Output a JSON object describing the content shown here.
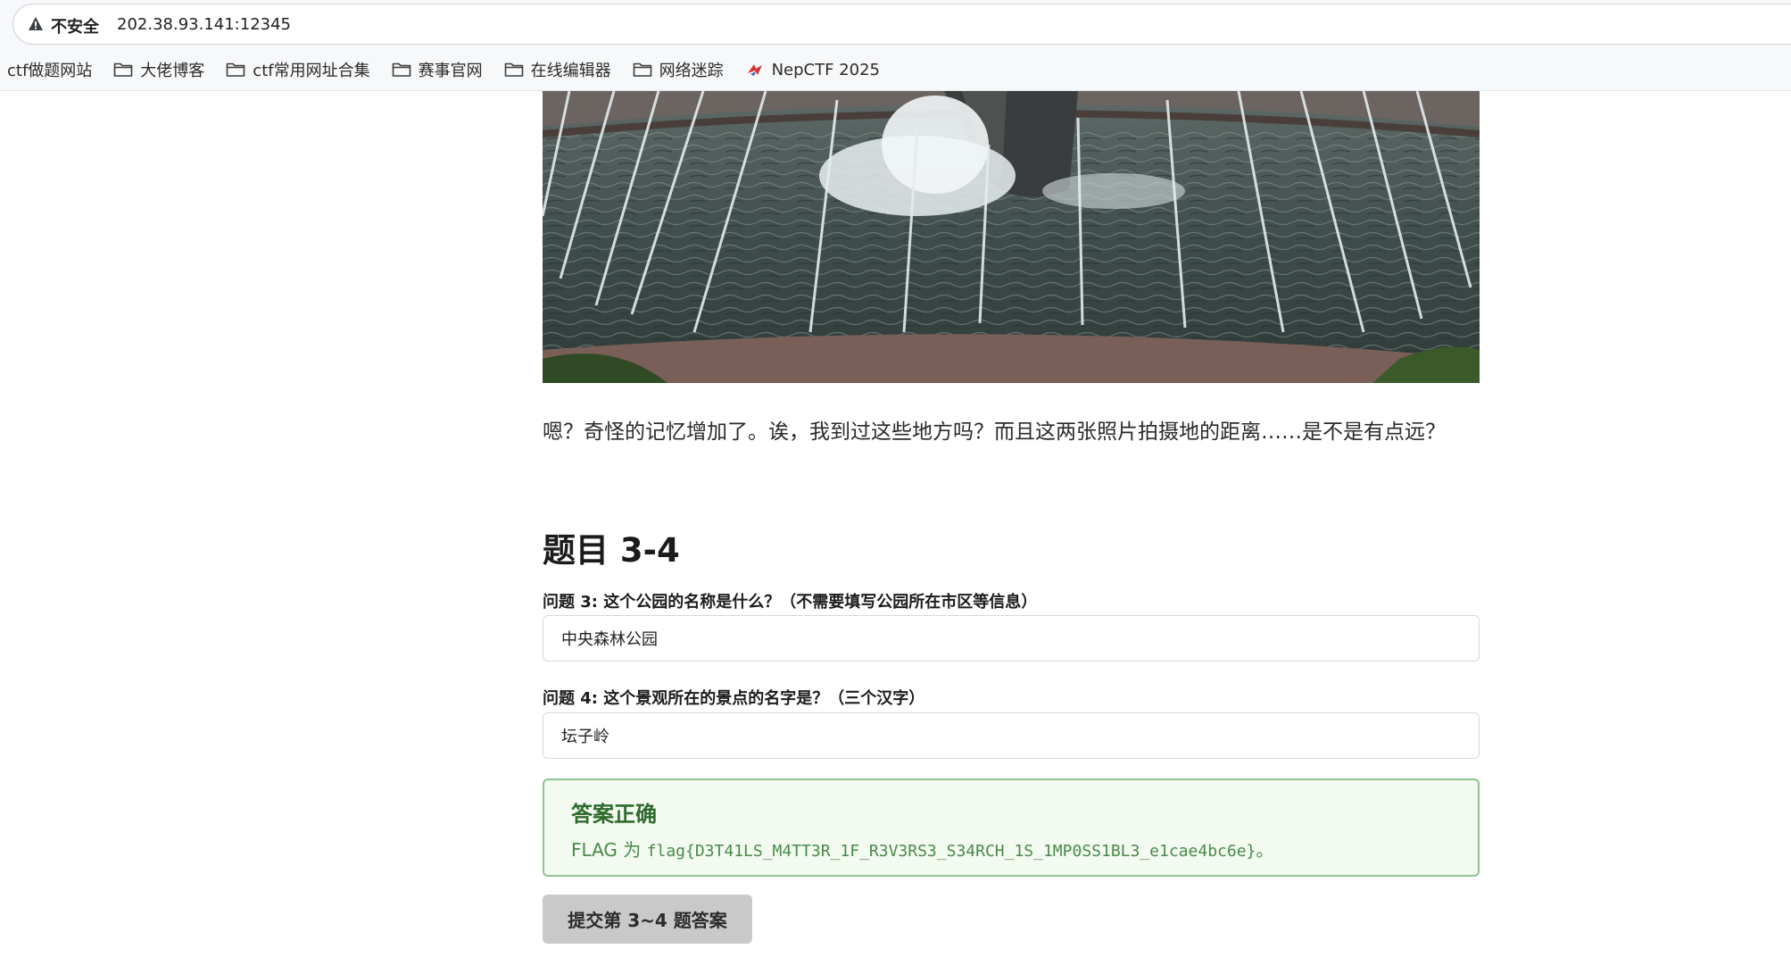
{
  "browser": {
    "security_label": "不安全",
    "url": "202.38.93.141:12345",
    "bookmarks": [
      {
        "label": "ctf做题网站",
        "icon": "folder-icon"
      },
      {
        "label": "大佬博客",
        "icon": "folder-icon"
      },
      {
        "label": "ctf常用网址合集",
        "icon": "folder-icon"
      },
      {
        "label": "赛事官网",
        "icon": "folder-icon"
      },
      {
        "label": "在线编辑器",
        "icon": "folder-icon"
      },
      {
        "label": "网络迷踪",
        "icon": "folder-icon"
      },
      {
        "label": "NepCTF 2025",
        "icon": "nepctf-favicon"
      }
    ]
  },
  "main": {
    "description": "嗯？奇怪的记忆增加了。诶，我到过这些地方吗？而且这两张照片拍摄地的距离……是不是有点远？",
    "section_title": "题目 3-4",
    "questions": [
      {
        "label": "问题 3: 这个公园的名称是什么？（不需要填写公园所在市区等信息）",
        "value": "中央森林公园"
      },
      {
        "label": "问题 4: 这个景观所在的景点的名字是？（三个汉字）",
        "value": "坛子岭"
      }
    ],
    "result": {
      "title": "答案正确",
      "prefix": "FLAG 为 ",
      "flag": "flag{D3T41LS_M4TT3R_1F_R3V3RS3_S34RCH_1S_1MP0SS1BL3_e1cae4bc6e}",
      "suffix": "。"
    },
    "submit_label": "提交第 3~4 题答案"
  },
  "colors": {
    "success_border": "#8fc48f",
    "success_bg": "#f3faf0",
    "success_text": "#2e6b2e",
    "button_bg": "#c9c9c9"
  }
}
